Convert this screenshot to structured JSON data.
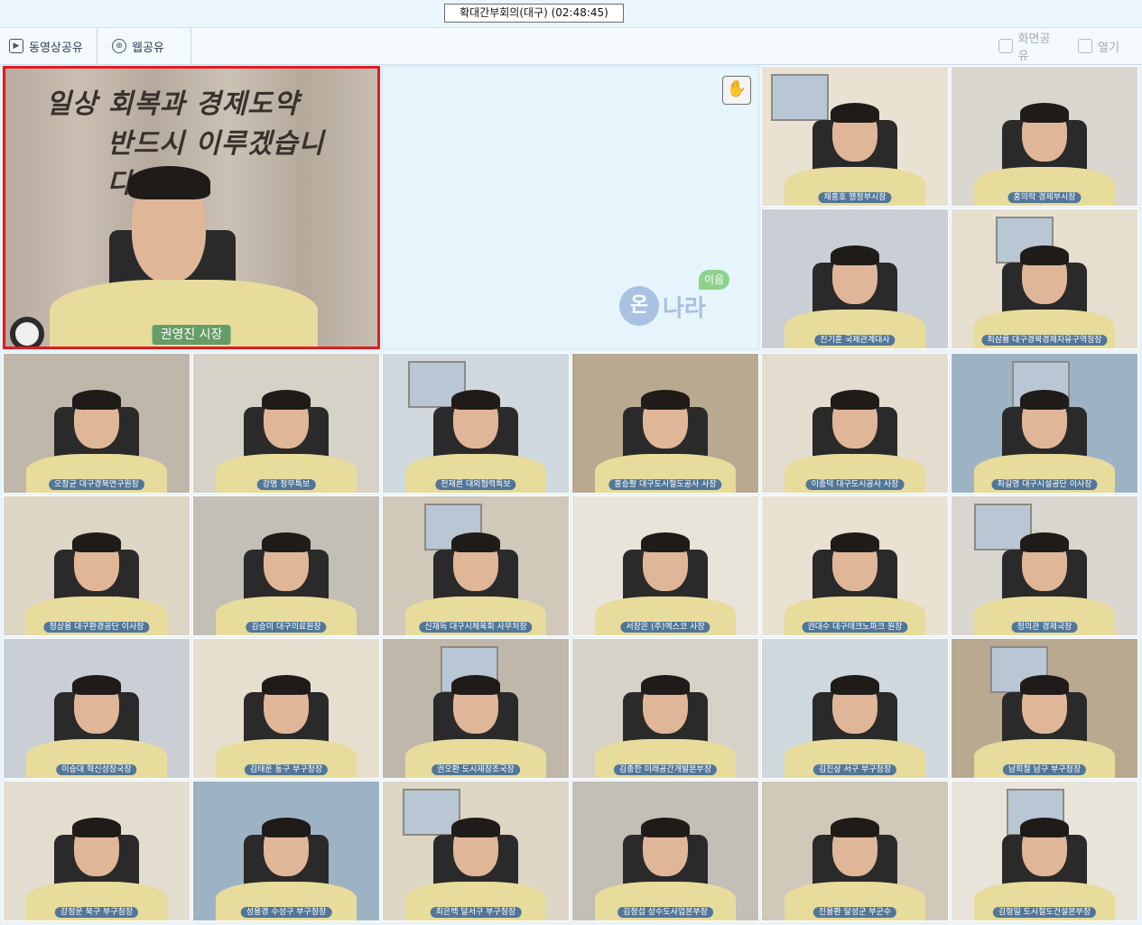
{
  "window": {
    "title": "확대간부회의(대구) (02:48:45)"
  },
  "toolbar": {
    "video_share": "동영상공유",
    "web_share": "웹공유",
    "screen_share": "화면공유",
    "open": "열기"
  },
  "main_speaker": {
    "slogan_line1": "일상 회복과 경제도약",
    "slogan_line2": "반드시 이루겠습니다.",
    "name": "권영진 시장"
  },
  "empty_tile": {
    "logo_main": "온",
    "logo_sub": "나라",
    "logo_badge": "이음"
  },
  "participants": [
    "채홍호 행정부시장",
    "홍의락 경제부시장",
    "진기훈 국제관계대사",
    "최삼룡 대구경북경제자유구역청장",
    "오창균 대구경북연구원장",
    "강명 정무특보",
    "천재른 대외협력특보",
    "홍승활 대구도시철도공사 사장",
    "이종덕 대구도시공사 사장",
    "최길영 대구시설공단 이사장",
    "정상용 대구환경공단 이사장",
    "김승미 대구의료원장",
    "신재득 대구시체육회 사무처장",
    "서장은 (주)엑스코 사장",
    "권대수 대구테크노파크 원장",
    "정의관 경제국장",
    "이승대 혁신성장국장",
    "김태운 동구 부구청장",
    "권오환 도시재창조국장",
    "김충한 미래공간개발본부장",
    "김진상 서구 부구청장",
    "남희철 남구 부구청장",
    "강정문 북구 부구청장",
    "성용경 수성구 부구청장",
    "최은백 달서구 부구청장",
    "김정섭 상수도사업본부장",
    "진용환 달성군 부군수",
    "김형일 도시철도건설본부장"
  ],
  "colors": {
    "active_border": "#e11b22",
    "background": "#e8f3f9",
    "label_bg": "#285a96"
  }
}
